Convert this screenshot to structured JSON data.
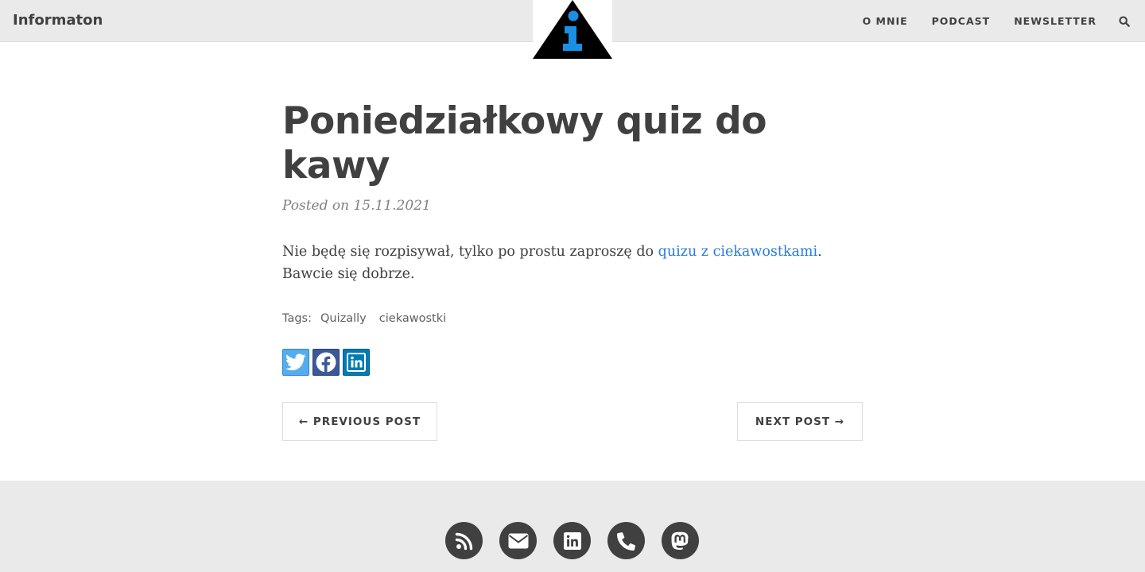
{
  "navbar": {
    "brand": "Informaton",
    "links": [
      "O MNIE",
      "PODCAST",
      "NEWSLETTER"
    ],
    "search_icon": "search-icon",
    "logo_icon": "info-triangle-logo"
  },
  "post": {
    "title": "Poniedziałkowy quiz do kawy",
    "meta": "Posted on 15.11.2021",
    "body_before": "Nie będę się rozpisywał, tylko po prostu zaproszę do ",
    "body_link": "quizu z ciekawostkami",
    "body_after": ". Bawcie się dobrze.",
    "link_color": "#2a7ae2",
    "tags_label": "Tags:",
    "tags": [
      "Quizally",
      "ciekawostki"
    ],
    "share": [
      {
        "icon": "twitter-icon",
        "color": "#55acee"
      },
      {
        "icon": "facebook-icon",
        "color": "#3b5998"
      },
      {
        "icon": "linkedin-icon",
        "color": "#007bb5"
      }
    ]
  },
  "pager": {
    "prev": "← PREVIOUS POST",
    "next": "NEXT POST →"
  },
  "footer": {
    "icons": [
      "rss-icon",
      "email-icon",
      "linkedin-icon",
      "phone-icon",
      "mastodon-icon"
    ]
  },
  "colors": {
    "navbar_bg": "#eaeaea",
    "text": "#404040",
    "logo_accent": "#1a8fe3"
  }
}
